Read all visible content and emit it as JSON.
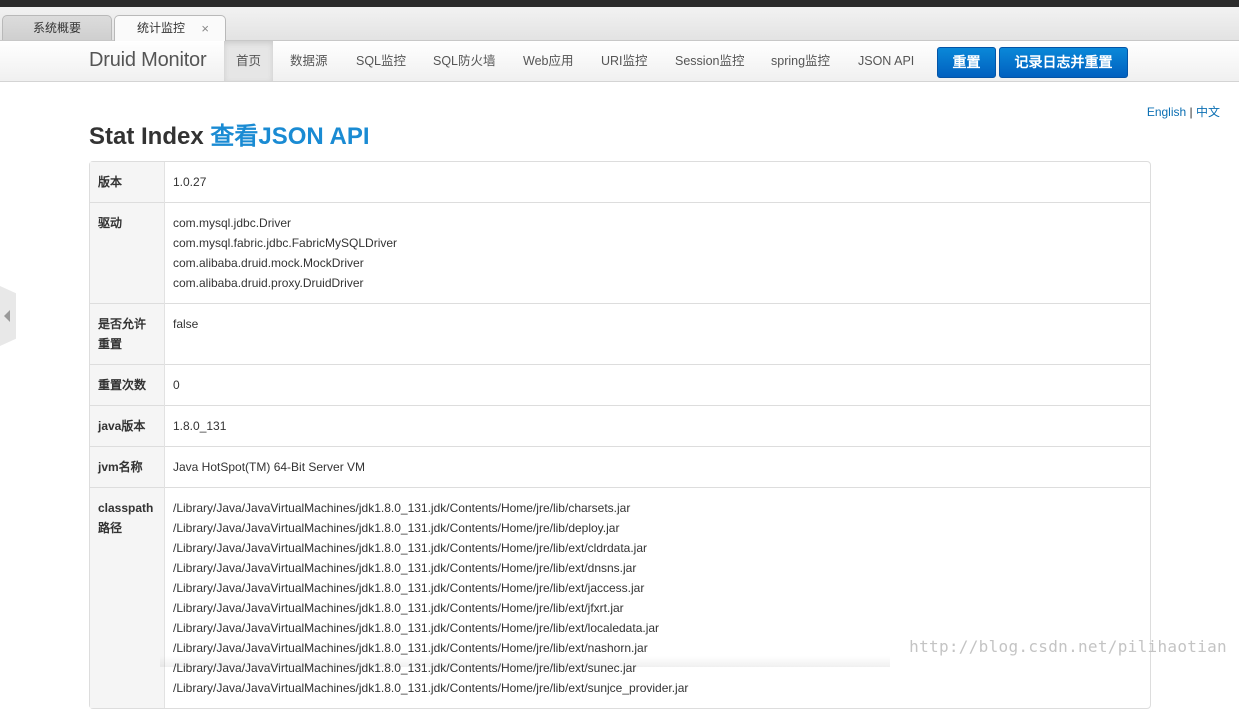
{
  "browser_tabs": [
    {
      "label": "系统概要",
      "active": false
    },
    {
      "label": "统计监控",
      "active": true,
      "close": "×"
    }
  ],
  "navbar": {
    "brand": "Druid Monitor",
    "items": [
      "首页",
      "数据源",
      "SQL监控",
      "SQL防火墙",
      "Web应用",
      "URI监控",
      "Session监控",
      "spring监控",
      "JSON API"
    ],
    "buttons": [
      "重置",
      "记录日志并重置"
    ]
  },
  "lang": {
    "en": "English",
    "sep": "|",
    "zh": "中文"
  },
  "title": {
    "main": "Stat Index",
    "link": "查看JSON API"
  },
  "rows": [
    {
      "key": "版本",
      "values": [
        "1.0.27"
      ]
    },
    {
      "key": "驱动",
      "values": [
        "com.mysql.jdbc.Driver",
        "com.mysql.fabric.jdbc.FabricMySQLDriver",
        "com.alibaba.druid.mock.MockDriver",
        "com.alibaba.druid.proxy.DruidDriver"
      ]
    },
    {
      "key": "是否允许重置",
      "values": [
        "false"
      ]
    },
    {
      "key": "重置次数",
      "values": [
        "0"
      ]
    },
    {
      "key": "java版本",
      "values": [
        "1.8.0_131"
      ]
    },
    {
      "key": "jvm名称",
      "values": [
        "Java HotSpot(TM) 64-Bit Server VM"
      ]
    },
    {
      "key": "classpath路径",
      "values": [
        "/Library/Java/JavaVirtualMachines/jdk1.8.0_131.jdk/Contents/Home/jre/lib/charsets.jar",
        "/Library/Java/JavaVirtualMachines/jdk1.8.0_131.jdk/Contents/Home/jre/lib/deploy.jar",
        "/Library/Java/JavaVirtualMachines/jdk1.8.0_131.jdk/Contents/Home/jre/lib/ext/cldrdata.jar",
        "/Library/Java/JavaVirtualMachines/jdk1.8.0_131.jdk/Contents/Home/jre/lib/ext/dnsns.jar",
        "/Library/Java/JavaVirtualMachines/jdk1.8.0_131.jdk/Contents/Home/jre/lib/ext/jaccess.jar",
        "/Library/Java/JavaVirtualMachines/jdk1.8.0_131.jdk/Contents/Home/jre/lib/ext/jfxrt.jar",
        "/Library/Java/JavaVirtualMachines/jdk1.8.0_131.jdk/Contents/Home/jre/lib/ext/localedata.jar",
        "/Library/Java/JavaVirtualMachines/jdk1.8.0_131.jdk/Contents/Home/jre/lib/ext/nashorn.jar",
        "/Library/Java/JavaVirtualMachines/jdk1.8.0_131.jdk/Contents/Home/jre/lib/ext/sunec.jar",
        "/Library/Java/JavaVirtualMachines/jdk1.8.0_131.jdk/Contents/Home/jre/lib/ext/sunjce_provider.jar"
      ]
    }
  ],
  "watermark": "http://blog.csdn.net/pilihaotian",
  "colors": {
    "accent": "#1a8bd3",
    "button": "#0a75cf"
  }
}
